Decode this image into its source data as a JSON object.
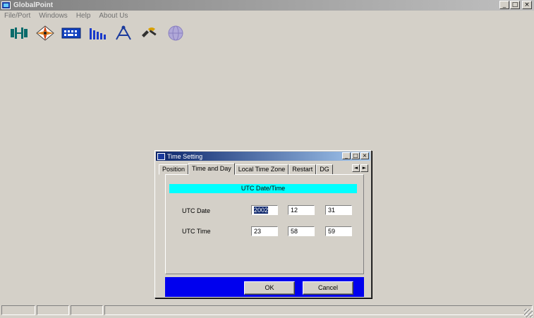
{
  "app": {
    "title": "GlobalPoint",
    "menu": [
      "File/Port",
      "Windows",
      "Help",
      "About Us"
    ],
    "toolbar_icons": [
      "connect-icon",
      "navigation-icon",
      "keyboard-icon",
      "signal-bars-icon",
      "satellite-icon",
      "tools-icon",
      "globe-icon"
    ],
    "caption_buttons": [
      "_",
      "□",
      "×"
    ]
  },
  "dialog": {
    "title": "Time Setting",
    "caption_buttons": [
      "_",
      "□",
      "×"
    ],
    "tabs": [
      "Position",
      "Time and Day",
      "Local Time Zone",
      "Restart",
      "DG"
    ],
    "active_tab": "Time and Day",
    "tab_scroll": [
      "◄",
      "►"
    ],
    "section_title": "UTC Date/Time",
    "date_label": "UTC Date",
    "date_values": [
      "2002",
      "12",
      "31"
    ],
    "time_label": "UTC Time",
    "time_values": [
      "23",
      "58",
      "59"
    ],
    "ok_label": "OK",
    "cancel_label": "Cancel"
  },
  "colors": {
    "header_bg": "#00ffff",
    "button_bar_bg": "#0000ee",
    "dialog_title_bg": "#0a246a"
  }
}
